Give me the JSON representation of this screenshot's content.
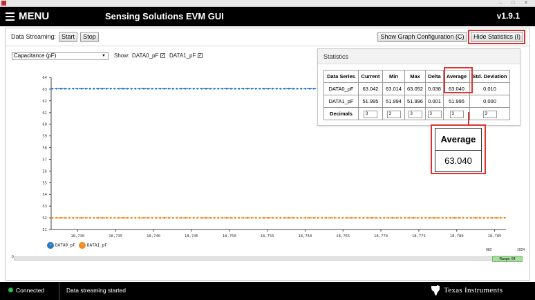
{
  "header": {
    "menu_label": "MENU",
    "title": "Sensing Solutions EVM GUI",
    "version": "v1.9.1"
  },
  "toolbar": {
    "streaming_label": "Data Streaming:",
    "start_label": "Start",
    "stop_label": "Stop",
    "graph_config_label": "Show Graph Configuration (C)",
    "hide_stats_label": "Hide Statistics (I)"
  },
  "controls": {
    "measurement_select": "Capacitance (pF)",
    "show_label": "Show:",
    "channels": [
      {
        "label": "DATA0_pF",
        "checked": true
      },
      {
        "label": "DATA1_pF",
        "checked": true
      }
    ]
  },
  "statistics": {
    "title": "Statistics",
    "headers": [
      "Data Series",
      "Current",
      "Min",
      "Max",
      "Delta",
      "Average",
      "Std. Deviation"
    ],
    "rows": [
      [
        "DATA0_pF",
        "63.042",
        "63.014",
        "63.052",
        "0.038",
        "63.040",
        "0.010"
      ],
      [
        "DATA1_pF",
        "51.995",
        "51.994",
        "51.996",
        "0.001",
        "51.995",
        "0.000"
      ]
    ],
    "decimals_label": "Decimals",
    "decimals": [
      "3",
      "3",
      "3",
      "3",
      "3",
      "3"
    ]
  },
  "zoom_callout": {
    "header": "Average",
    "value": "63.040"
  },
  "chart_data": {
    "type": "line",
    "ylim": [
      51,
      64
    ],
    "y_ticks": [
      "64",
      "63",
      "62",
      "61",
      "60",
      "59",
      "58",
      "57",
      "56",
      "55",
      "54",
      "53",
      "52",
      "51"
    ],
    "x_ticks": [
      "18,730",
      "18,735",
      "18,740",
      "18,745",
      "18,750",
      "18,755",
      "18,760",
      "18,765",
      "18,770",
      "18,775",
      "18,780",
      "18,785"
    ],
    "series": [
      {
        "name": "DATA0_pF",
        "color": "#2b78c2",
        "value": 63.04
      },
      {
        "name": "DATA1_pF",
        "color": "#f28a1f",
        "value": 51.995
      }
    ],
    "grid": false,
    "legend": "bottom-left"
  },
  "slider": {
    "min_label": "0",
    "window_start_label": "960",
    "window_end_label": "1024",
    "range_label": "Range: 64"
  },
  "status": {
    "connection": "Connected",
    "message": "Data streaming started",
    "brand": "Texas Instruments"
  },
  "colors": {
    "accent_red": "#e03030",
    "series0": "#2b78c2",
    "series1": "#f28a1f",
    "connected": "#2dbb4a"
  }
}
